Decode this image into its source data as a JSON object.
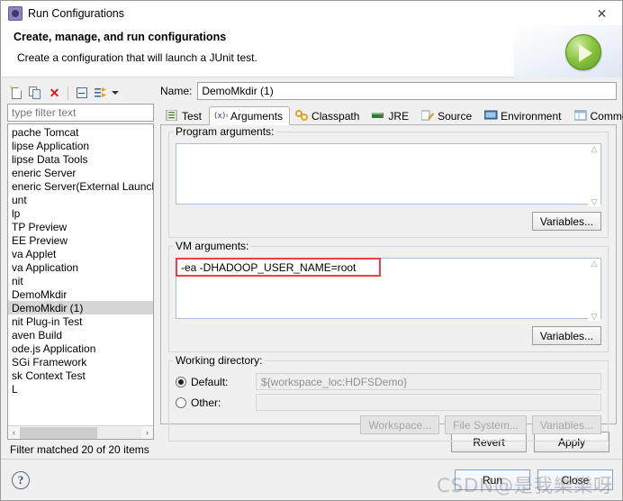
{
  "window": {
    "title": "Run Configurations",
    "app_icon": "run-configurations-icon",
    "close_icon": "✕"
  },
  "header": {
    "title": "Create, manage, and run configurations",
    "subtitle": "Create a configuration that will launch a JUnit test.",
    "run_icon": "run-play-icon"
  },
  "sidebar": {
    "toolbar": {
      "new_icon": "new-launch-configuration-icon",
      "duplicate_icon": "duplicate-icon",
      "delete_icon": "✕",
      "collapse_icon": "collapse-all-icon",
      "filter_icon": "filter-launch-configurations-icon",
      "dropdown_icon": "chevron-down-icon"
    },
    "filter_placeholder": "type filter text",
    "filter_value": "",
    "items": [
      {
        "label": "pache Tomcat",
        "type": "config"
      },
      {
        "label": "lipse Application",
        "type": "config"
      },
      {
        "label": "lipse Data Tools",
        "type": "config"
      },
      {
        "label": "eneric Server",
        "type": "config"
      },
      {
        "label": "eneric Server(External Launch)",
        "type": "config"
      },
      {
        "label": "unt",
        "type": "config"
      },
      {
        "label": "lp",
        "type": "config"
      },
      {
        "label": "TP Preview",
        "type": "config"
      },
      {
        "label": "EE Preview",
        "type": "config"
      },
      {
        "label": "va Applet",
        "type": "config"
      },
      {
        "label": "va Application",
        "type": "config"
      },
      {
        "label": "nit",
        "type": "config"
      },
      {
        "label": "DemoMkdir",
        "type": "junit-launch"
      },
      {
        "label": "DemoMkdir (1)",
        "type": "junit-launch",
        "selected": true
      },
      {
        "label": "nit Plug-in Test",
        "type": "config"
      },
      {
        "label": "aven Build",
        "type": "config"
      },
      {
        "label": "ode.js Application",
        "type": "config"
      },
      {
        "label": "SGi Framework",
        "type": "config"
      },
      {
        "label": "sk Context Test",
        "type": "config"
      },
      {
        "label": "L",
        "type": "config"
      }
    ],
    "hscroll": {
      "left_arrow": "‹",
      "right_arrow": "›"
    },
    "status": "Filter matched 20 of 20 items"
  },
  "main": {
    "name_label": "Name:",
    "name_value": "DemoMkdir (1)",
    "tabs": [
      {
        "label": "Test",
        "icon": "test-icon",
        "active": false
      },
      {
        "label": "Arguments",
        "icon": "arguments-icon",
        "active": true
      },
      {
        "label": "Classpath",
        "icon": "classpath-icon",
        "active": false
      },
      {
        "label": "JRE",
        "icon": "jre-icon",
        "active": false
      },
      {
        "label": "Source",
        "icon": "source-icon",
        "active": false
      },
      {
        "label": "Environment",
        "icon": "environment-icon",
        "active": false
      },
      {
        "label": "Common",
        "icon": "common-icon",
        "active": false
      }
    ],
    "program_arguments": {
      "label": "Program arguments:",
      "value": "",
      "variables_button": "Variables..."
    },
    "vm_arguments": {
      "label": "VM arguments:",
      "value": "-ea -DHADOOP_USER_NAME=root",
      "variables_button": "Variables...",
      "highlight_color": "#f04040"
    },
    "working_directory": {
      "label": "Working directory:",
      "default_label": "Default:",
      "default_value": "${workspace_loc:HDFSDemo}",
      "default_selected": true,
      "other_label": "Other:",
      "other_value": "",
      "workspace_button": "Workspace...",
      "file_system_button": "File System...",
      "variables_button": "Variables..."
    },
    "revert_button": "Revert",
    "apply_button": "Apply"
  },
  "footer": {
    "help_icon": "?",
    "run_button": "Run",
    "close_button": "Close"
  },
  "watermark": "CSDN@是我樂樂呀"
}
